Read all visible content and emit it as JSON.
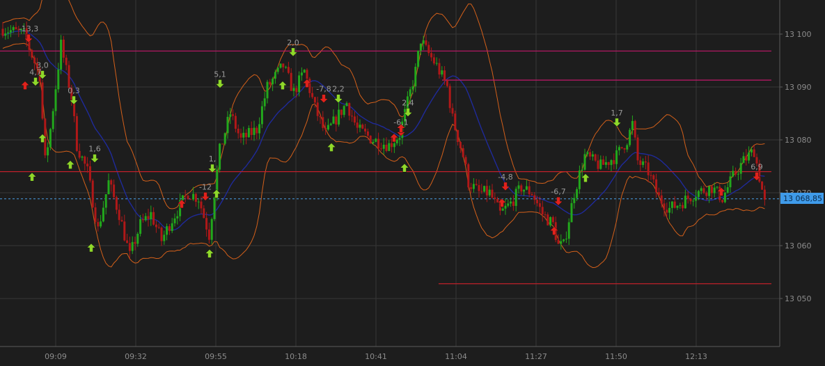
{
  "chart_data": {
    "type": "candlestick",
    "x": {
      "ticks": [
        "09:09",
        "09:32",
        "09:55",
        "10:18",
        "10:41",
        "11:04",
        "11:27",
        "11:50",
        "12:13"
      ]
    },
    "y": {
      "ticks": [
        13050,
        13060,
        13070,
        13080,
        13090,
        13100
      ],
      "tick_labels": [
        "13 050",
        "13 060",
        "13 070",
        "13 080",
        "13 090",
        "13 100"
      ],
      "range": [
        13040.5,
        13105.5
      ]
    },
    "grid": true,
    "current_price": {
      "value": 13068.85,
      "label": "13 068,85"
    },
    "levels": [
      {
        "value": 13096.8,
        "from": "start",
        "to": "end",
        "color": "#c2186a"
      },
      {
        "value": 13091.3,
        "from": "11:00",
        "to": "end",
        "color": "#c2186a"
      },
      {
        "value": 13074.0,
        "from": "start",
        "to": "end",
        "color": "#c0202a"
      },
      {
        "value": 13052.8,
        "from": "10:59",
        "to": "end",
        "color": "#c0202a"
      }
    ],
    "colors": {
      "up": "#22a81c",
      "down": "#b01818",
      "ma": "#1f2a9a",
      "bands": "#d4601a",
      "buy": "#8fd82a",
      "sell": "#e0221c"
    },
    "signal_labels": [
      "-13,3",
      "4,7",
      "3,0",
      "0,3",
      "1,6",
      "-12",
      "1,",
      "5,1",
      "2,0",
      "-7,8",
      "2,2",
      "2,4",
      "-6,1",
      "-4,8",
      "-6,7",
      "1,7",
      "6,9"
    ]
  }
}
